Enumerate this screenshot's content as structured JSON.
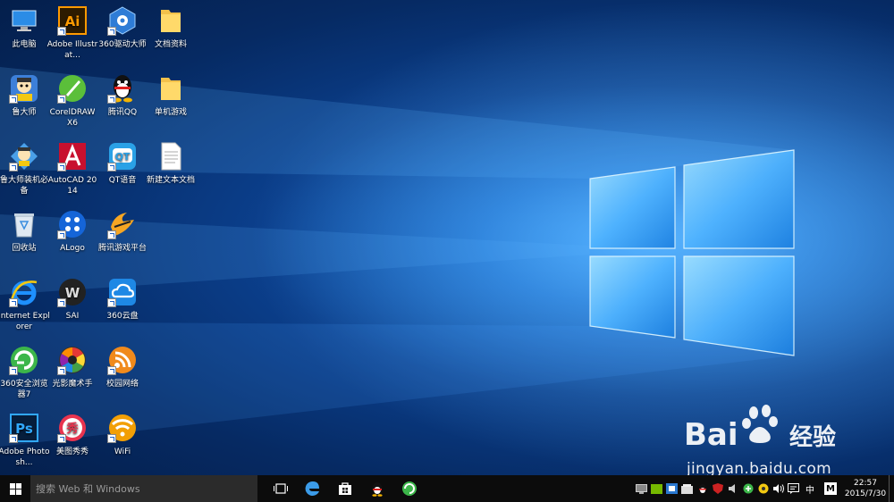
{
  "desktop": {
    "icons": [
      {
        "label": "此电脑",
        "icon": "computer-icon"
      },
      {
        "label": "Adobe Illustrat...",
        "icon": "illustrator-icon"
      },
      {
        "label": "360驱动大师",
        "icon": "driver-icon"
      },
      {
        "label": "文档资料",
        "icon": "folder-icon"
      },
      {
        "label": "鲁大师",
        "icon": "ludashi-icon"
      },
      {
        "label": "CorelDRAW X6",
        "icon": "coreldraw-icon"
      },
      {
        "label": "腾讯QQ",
        "icon": "qq-icon"
      },
      {
        "label": "单机游戏",
        "icon": "folder-icon"
      },
      {
        "label": "鲁大师装机必备",
        "icon": "ludashi-install-icon"
      },
      {
        "label": "AutoCAD 2014",
        "icon": "autocad-icon"
      },
      {
        "label": "QT语音",
        "icon": "qt-icon"
      },
      {
        "label": "新建文本文档",
        "icon": "text-file-icon"
      },
      {
        "label": "回收站",
        "icon": "recycle-bin-icon"
      },
      {
        "label": "ALogo",
        "icon": "alogo-icon"
      },
      {
        "label": "腾讯游戏平台",
        "icon": "tencent-games-icon"
      },
      {
        "label": "Internet Explorer",
        "icon": "ie-icon"
      },
      {
        "label": "SAI",
        "icon": "sai-icon"
      },
      {
        "label": "360云盘",
        "icon": "cloud-icon"
      },
      {
        "label": "360安全浏览器7",
        "icon": "360-browser-icon"
      },
      {
        "label": "光影魔术手",
        "icon": "nevercenter-icon"
      },
      {
        "label": "校园网络",
        "icon": "campus-network-icon"
      },
      {
        "label": "Adobe Photosh...",
        "icon": "photoshop-icon"
      },
      {
        "label": "美图秀秀",
        "icon": "meitu-icon"
      },
      {
        "label": "WiFi",
        "icon": "wifi-icon"
      }
    ]
  },
  "watermark": {
    "site": "jingyan.baidu.com",
    "logo_text": "Bai",
    "logo_cn": "经验"
  },
  "taskbar": {
    "search_placeholder": "搜索 Web 和 Windows",
    "pinned": [
      "task-view-icon",
      "edge-icon",
      "store-icon",
      "qq-icon",
      "360-browser-icon"
    ],
    "tray": {
      "ime": "中",
      "ime_box": "M",
      "time": "22:57",
      "date": "2015/7/30"
    }
  },
  "colors": {
    "accent": "#0078d7",
    "taskbar": "#0c0c0c",
    "search_bg": "#2b2b2b"
  }
}
